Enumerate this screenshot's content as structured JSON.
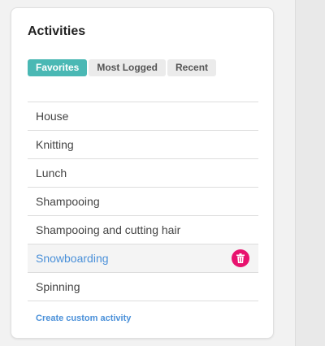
{
  "panel": {
    "title": "Activities"
  },
  "tabs": [
    {
      "label": "Favorites",
      "active": true
    },
    {
      "label": "Most Logged",
      "active": false
    },
    {
      "label": "Recent",
      "active": false
    }
  ],
  "activities": [
    {
      "label": "House"
    },
    {
      "label": "Knitting"
    },
    {
      "label": "Lunch"
    },
    {
      "label": "Shampooing"
    },
    {
      "label": "Shampooing and cutting hair"
    },
    {
      "label": "Snowboarding",
      "selected": true
    },
    {
      "label": "Spinning"
    }
  ],
  "create_link": "Create custom activity",
  "icons": {
    "delete": "trash-icon"
  },
  "colors": {
    "accent": "#4ab8b4",
    "link": "#4a90d9",
    "delete": "#e8126e"
  }
}
